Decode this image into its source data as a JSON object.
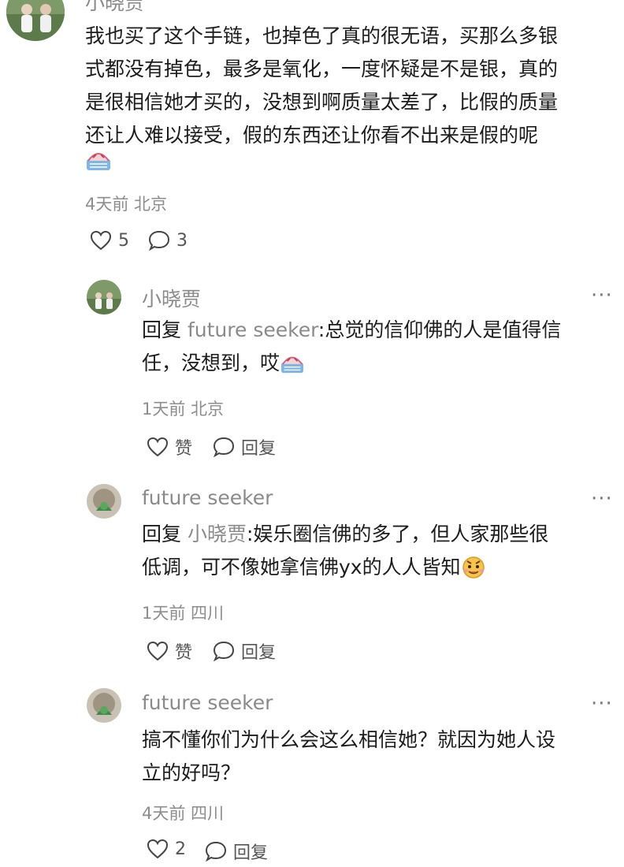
{
  "top_comment": {
    "author": "小晓贾",
    "body": "我也买了这个手链，也掉色了真的很无语，买那么多银式都没有掉色，最多是氧化，一度怀疑是不是银，真的是很相信她才买的，没想到啊质量太差了，比假的质量还让人难以接受，假的东西还让你看不出来是假的呢",
    "lines": [
      "我也买了这个手链，也掉色了真的很无语，买那么多银",
      "式都没有掉色，最多是氧化，一度怀疑是不是银，真的",
      "是很相信她才买的，没想到啊质量太差了，比假的质量",
      "还让人难以接受，假的东西还让你看不出来是假的呢"
    ],
    "meta": "4天前 北京",
    "likes": "5",
    "replies": "3"
  },
  "replies": [
    {
      "author": "小晓贾",
      "reply_prefix": "回复",
      "reply_to": "future seeker",
      "line1": ":总觉的信仰佛的人是值得信",
      "line2": "任，没想到，哎",
      "meta": "1天前 北京",
      "like_label": "赞",
      "reply_label": "回复"
    },
    {
      "author": "future seeker",
      "reply_prefix": "回复",
      "reply_to": "小晓贾",
      "line1": ":娱乐圈信佛的多了，但人家那些很",
      "line2": "低调，可不像她拿信佛yx的人人皆知",
      "meta": "1天前 四川",
      "like_label": "赞",
      "reply_label": "回复"
    },
    {
      "author": "future seeker",
      "line1": "搞不懂你们为什么会这么相信她？就因为她人设",
      "line2": "立的好吗？",
      "meta": "4天前 四川",
      "likes": "2",
      "reply_label": "回复"
    }
  ],
  "more_label": "···",
  "colors": {
    "name": "#8a8a8a",
    "text": "#1c1c1c",
    "meta": "#8d8d8d",
    "reply_to": "#8a8a8a"
  }
}
